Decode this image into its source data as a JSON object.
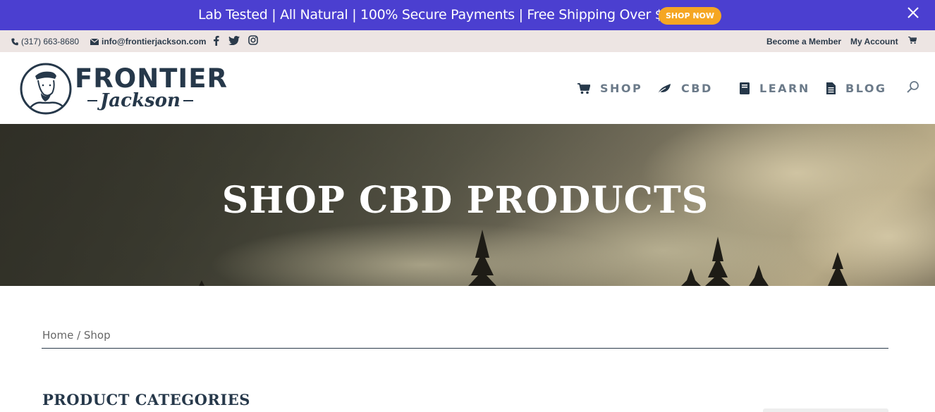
{
  "promo": {
    "text": "Lab Tested | All Natural | 100% Secure Payments | Free Shipping Over $100",
    "button": "SHOP NOW"
  },
  "utility": {
    "phone": "(317) 663-8680",
    "email": "info@frontierjackson.com",
    "become_member": "Become a Member",
    "my_account": "My Account"
  },
  "logo": {
    "line1": "FRONTIER",
    "line2": "Jackson"
  },
  "nav": [
    {
      "label": "SHOP",
      "icon": "cart-icon"
    },
    {
      "label": "CBD",
      "icon": "leaf-icon"
    },
    {
      "label": "LEARN",
      "icon": "book-icon"
    },
    {
      "label": "BLOG",
      "icon": "document-icon"
    }
  ],
  "hero": {
    "title": "SHOP CBD PRODUCTS"
  },
  "breadcrumb": "Home / Shop",
  "section": {
    "title": "PRODUCT CATEGORIES"
  },
  "colors": {
    "promo_bg": "#4b3fd0",
    "promo_button": "#f5a623",
    "utility_bg": "#ede5e3",
    "brand_navy": "#26384a",
    "nav_text": "#6b7a89"
  }
}
